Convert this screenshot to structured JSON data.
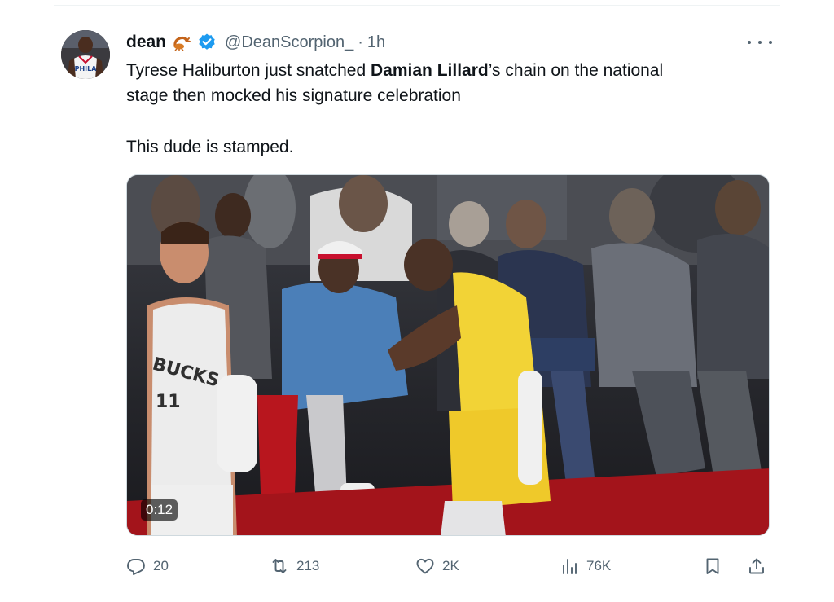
{
  "tweet": {
    "author_name": "dean",
    "handle": "@DeanScorpion_",
    "separator": "·",
    "time": "1h",
    "text_line1_before": "Tyrese Haliburton just snatched ",
    "text_line1_bold": "Damian Lillard",
    "text_line1_after": "’s chain on the national",
    "text_line2": "stage then mocked his signature celebration",
    "text_line3": "This dude is stamped.",
    "video_duration": "0:12",
    "jersey_text": "BUCKS",
    "jersey_number": "11",
    "avatar_jersey_text": "PHILA"
  },
  "actions": {
    "replies": "20",
    "reposts": "213",
    "likes": "2K",
    "views": "76K"
  },
  "icons": {
    "more": "more-horizontal-icon",
    "verified": "verified-badge-icon",
    "scorpion": "scorpion-emoji-icon",
    "reply": "reply-icon",
    "repost": "repost-icon",
    "like": "heart-icon",
    "views": "views-chart-icon",
    "bookmark": "bookmark-icon",
    "share": "share-icon"
  },
  "colors": {
    "verified_blue": "#1d9bf0",
    "text_primary": "#0f1419",
    "text_secondary": "#536471",
    "jersey_yellow": "#f2d336",
    "court_red": "#a3141b"
  }
}
